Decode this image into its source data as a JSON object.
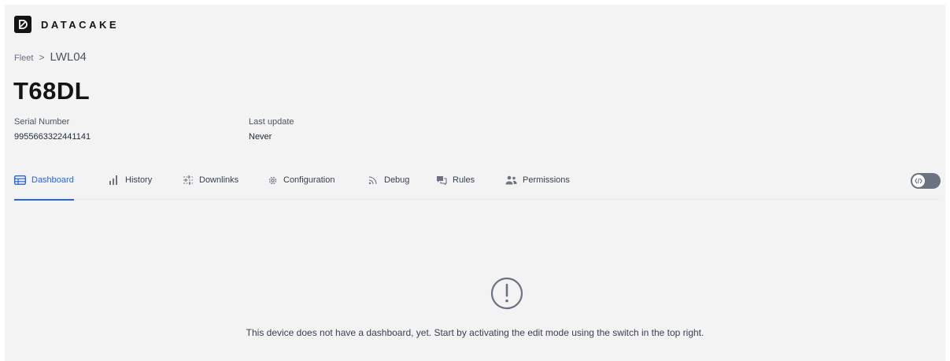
{
  "brand": {
    "name": "DATACAKE",
    "icon": "datacake-logo-icon"
  },
  "breadcrumb": {
    "root": "Fleet",
    "separator": ">",
    "current": "LWL04"
  },
  "device": {
    "title": "T68DL",
    "serial_label": "Serial Number",
    "serial_value": "9955663322441141",
    "last_update_label": "Last update",
    "last_update_value": "Never"
  },
  "tabs": [
    {
      "label": "Dashboard",
      "icon": "dashboard-grid-icon",
      "active": true
    },
    {
      "label": "History",
      "icon": "bar-chart-icon",
      "active": false
    },
    {
      "label": "Downlinks",
      "icon": "sliders-icon",
      "active": false
    },
    {
      "label": "Configuration",
      "icon": "gear-icon",
      "active": false
    },
    {
      "label": "Debug",
      "icon": "rss-icon",
      "active": false
    },
    {
      "label": "Rules",
      "icon": "chat-bubbles-icon",
      "active": false
    },
    {
      "label": "Permissions",
      "icon": "users-icon",
      "active": false
    }
  ],
  "edit_mode": {
    "enabled": false,
    "icon": "code-icon"
  },
  "empty_state": {
    "icon": "exclamation-circle-icon",
    "message": "This device does not have a dashboard, yet. Start by activating the edit mode using the switch in the top right."
  },
  "colors": {
    "accent": "#2563eb",
    "background": "#f3f3f3",
    "toggle_off": "#6b7280"
  }
}
